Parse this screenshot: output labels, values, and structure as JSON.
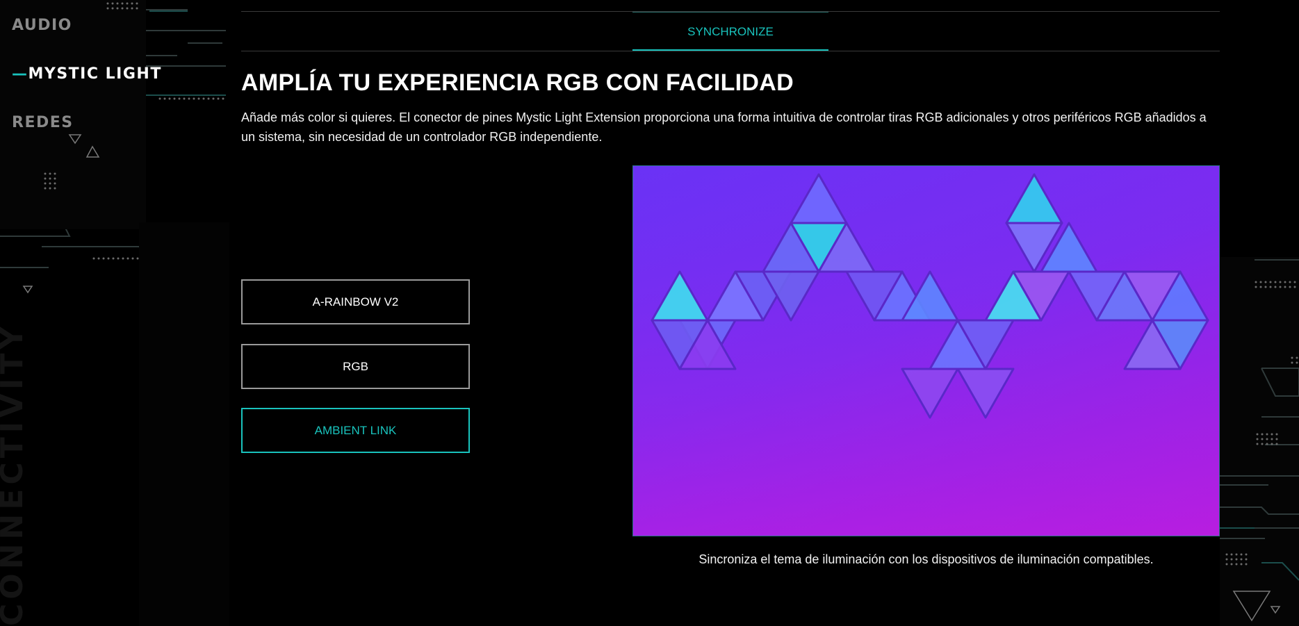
{
  "sidebar": {
    "watermark": "CONNECTIVITY",
    "items": [
      {
        "label": "AUDIO",
        "active": false
      },
      {
        "label": "MYSTIC LIGHT",
        "active": true,
        "marker": "—"
      },
      {
        "label": "REDES",
        "active": false
      }
    ]
  },
  "tabs": [
    {
      "label": "SYNCHRONIZE",
      "active": true
    }
  ],
  "section": {
    "title": "AMPLÍA TU EXPERIENCIA RGB CON FACILIDAD",
    "description": "Añade más color si quieres. El conector de pines Mystic Light Extension proporciona una forma intuitiva de controlar tiras RGB adicionales y otros periféricos RGB añadidos a un sistema, sin necesidad de un controlador RGB independiente."
  },
  "options": [
    {
      "label": "A-RAINBOW V2",
      "active": false
    },
    {
      "label": "RGB",
      "active": false
    },
    {
      "label": "AMBIENT LINK",
      "active": true
    }
  ],
  "media": {
    "alt": "Paneles triangulares de iluminación RGB en la pared",
    "caption": "Sincroniza el tema de iluminación con los dispositivos de iluminación compatibles."
  },
  "colors": {
    "accent": "#19c3bd",
    "background": "#000000",
    "inactive_nav": "#8a8a8a",
    "button_border": "#9a9a9a"
  }
}
